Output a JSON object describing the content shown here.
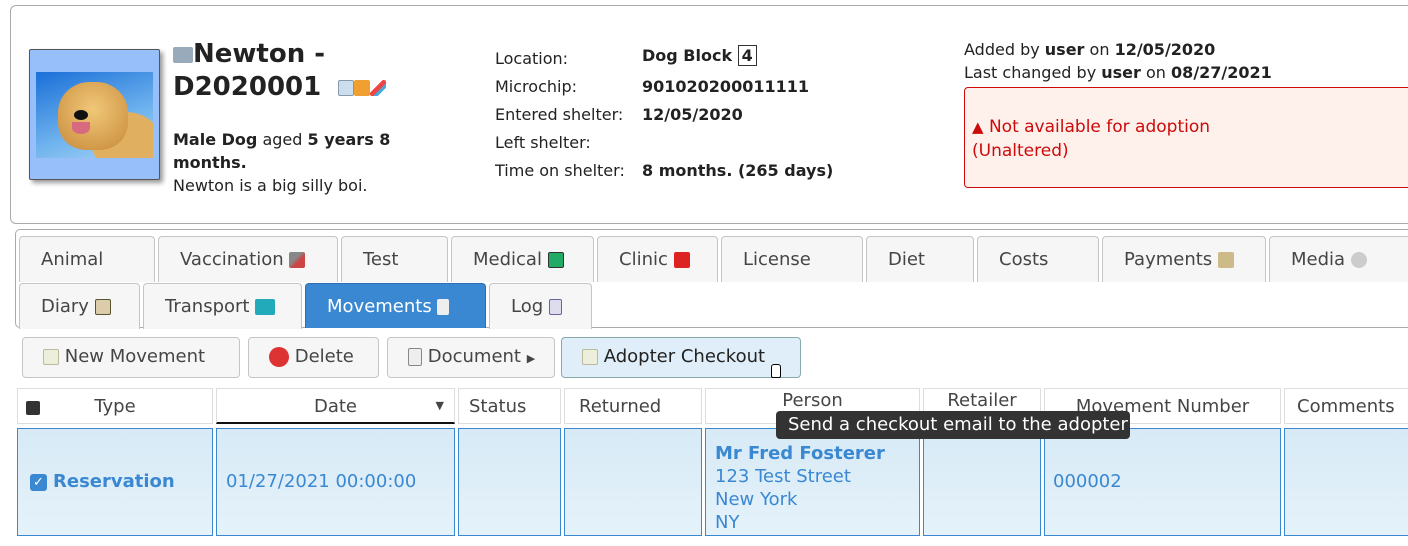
{
  "animal": {
    "name": "Newton - D2020001",
    "sex_species": "Male Dog",
    "aged_word": "aged",
    "age": "5 years 8 months.",
    "description": "Newton is a big silly boi."
  },
  "details": {
    "location_label": "Location:",
    "location": "Dog Block",
    "location_unit": "4",
    "microchip_label": "Microchip:",
    "microchip": "901020200011111",
    "entered_label": "Entered shelter:",
    "entered": "12/05/2020",
    "left_label": "Left shelter:",
    "left": "",
    "time_label": "Time on shelter:",
    "time": "8 months. (265 days)"
  },
  "audit": {
    "added_prefix": "Added by",
    "added_user": "user",
    "on": "on",
    "added_date": "12/05/2020",
    "changed_prefix": "Last changed by",
    "changed_user": "user",
    "changed_date": "08/27/2021"
  },
  "alert": {
    "line1": "Not available for adoption",
    "line2": "(Unaltered)",
    "color": "#cd0a0a"
  },
  "tabs": [
    {
      "label": "Animal"
    },
    {
      "label": "Vaccination"
    },
    {
      "label": "Test"
    },
    {
      "label": "Medical"
    },
    {
      "label": "Clinic"
    },
    {
      "label": "License"
    },
    {
      "label": "Diet"
    },
    {
      "label": "Costs"
    },
    {
      "label": "Payments"
    },
    {
      "label": "Media"
    },
    {
      "label": "Diary"
    },
    {
      "label": "Transport"
    },
    {
      "label": "Movements",
      "active": true
    },
    {
      "label": "Log"
    }
  ],
  "toolbar": {
    "new": "New Movement",
    "delete": "Delete",
    "document": "Document",
    "checkout": "Adopter Checkout"
  },
  "tooltip": "Send a checkout email to the adopter",
  "table": {
    "headers": [
      "Type",
      "Date",
      "Status",
      "Returned",
      "Person",
      "Retailer",
      "Movement Number",
      "Comments"
    ],
    "rows": [
      {
        "type": "Reservation",
        "date": "01/27/2021 00:00:00",
        "status": "",
        "returned": "",
        "person_name": "Mr Fred Fosterer",
        "address1": "123 Test Street",
        "city": "New York",
        "state": "NY",
        "retailer": "",
        "movement_number": "000002",
        "comments": "",
        "checked": true
      }
    ]
  },
  "accent": "#3a88d1"
}
